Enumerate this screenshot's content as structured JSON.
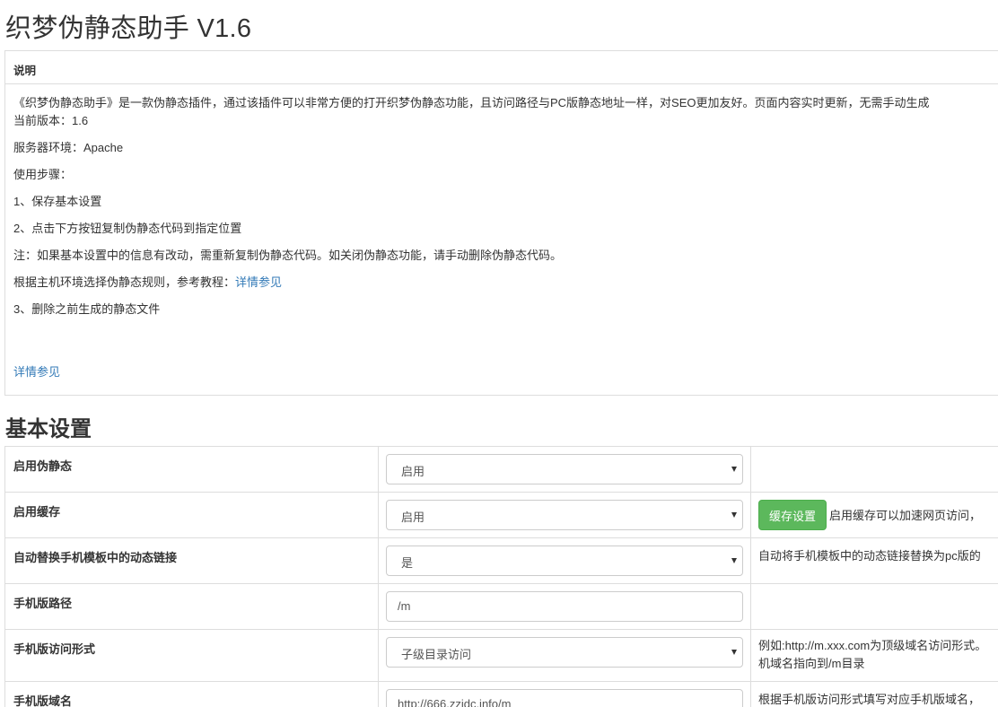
{
  "page_title": "织梦伪静态助手 V1.6",
  "info": {
    "heading": "说明",
    "intro": "《织梦伪静态助手》是一款伪静态插件，通过该插件可以非常方便的打开织梦伪静态功能，且访问路径与PC版静态地址一样，对SEO更加友好。页面内容实时更新，无需手动生成",
    "version": "当前版本：1.6",
    "server": "服务器环境：Apache",
    "steps_title": "使用步骤：",
    "step1": "1、保存基本设置",
    "step2": "2、点击下方按钮复制伪静态代码到指定位置",
    "note": "注：如果基本设置中的信息有改动，需重新复制伪静态代码。如关闭伪静态功能，请手动删除伪静态代码。",
    "rule_prefix": "根据主机环境选择伪静态规则，参考教程：",
    "rule_link": "详情参见",
    "step3": "3、删除之前生成的静态文件",
    "bottom_link": "详情参见"
  },
  "settings_title": "基本设置",
  "settings": {
    "rewrite": {
      "label": "启用伪静态",
      "value": "启用"
    },
    "cache": {
      "label": "启用缓存",
      "value": "启用",
      "button": "缓存设置",
      "desc": "启用缓存可以加速网页访问，"
    },
    "mobile_links": {
      "label": "自动替换手机模板中的动态链接",
      "value": "是",
      "desc": "自动将手机模板中的动态链接替换为pc版的"
    },
    "mobile_path": {
      "label": "手机版路径",
      "value": "/m"
    },
    "access_mode": {
      "label": "手机版访问形式",
      "value": "子级目录访问",
      "desc_line1": "例如:http://m.xxx.com为顶级域名访问形式。",
      "desc_line2": "机域名指向到/m目录"
    },
    "mobile_domain": {
      "label": "手机版域名",
      "value": "http://666.zzidc.info/m",
      "desc": "根据手机版访问形式填写对应手机版域名，"
    }
  }
}
